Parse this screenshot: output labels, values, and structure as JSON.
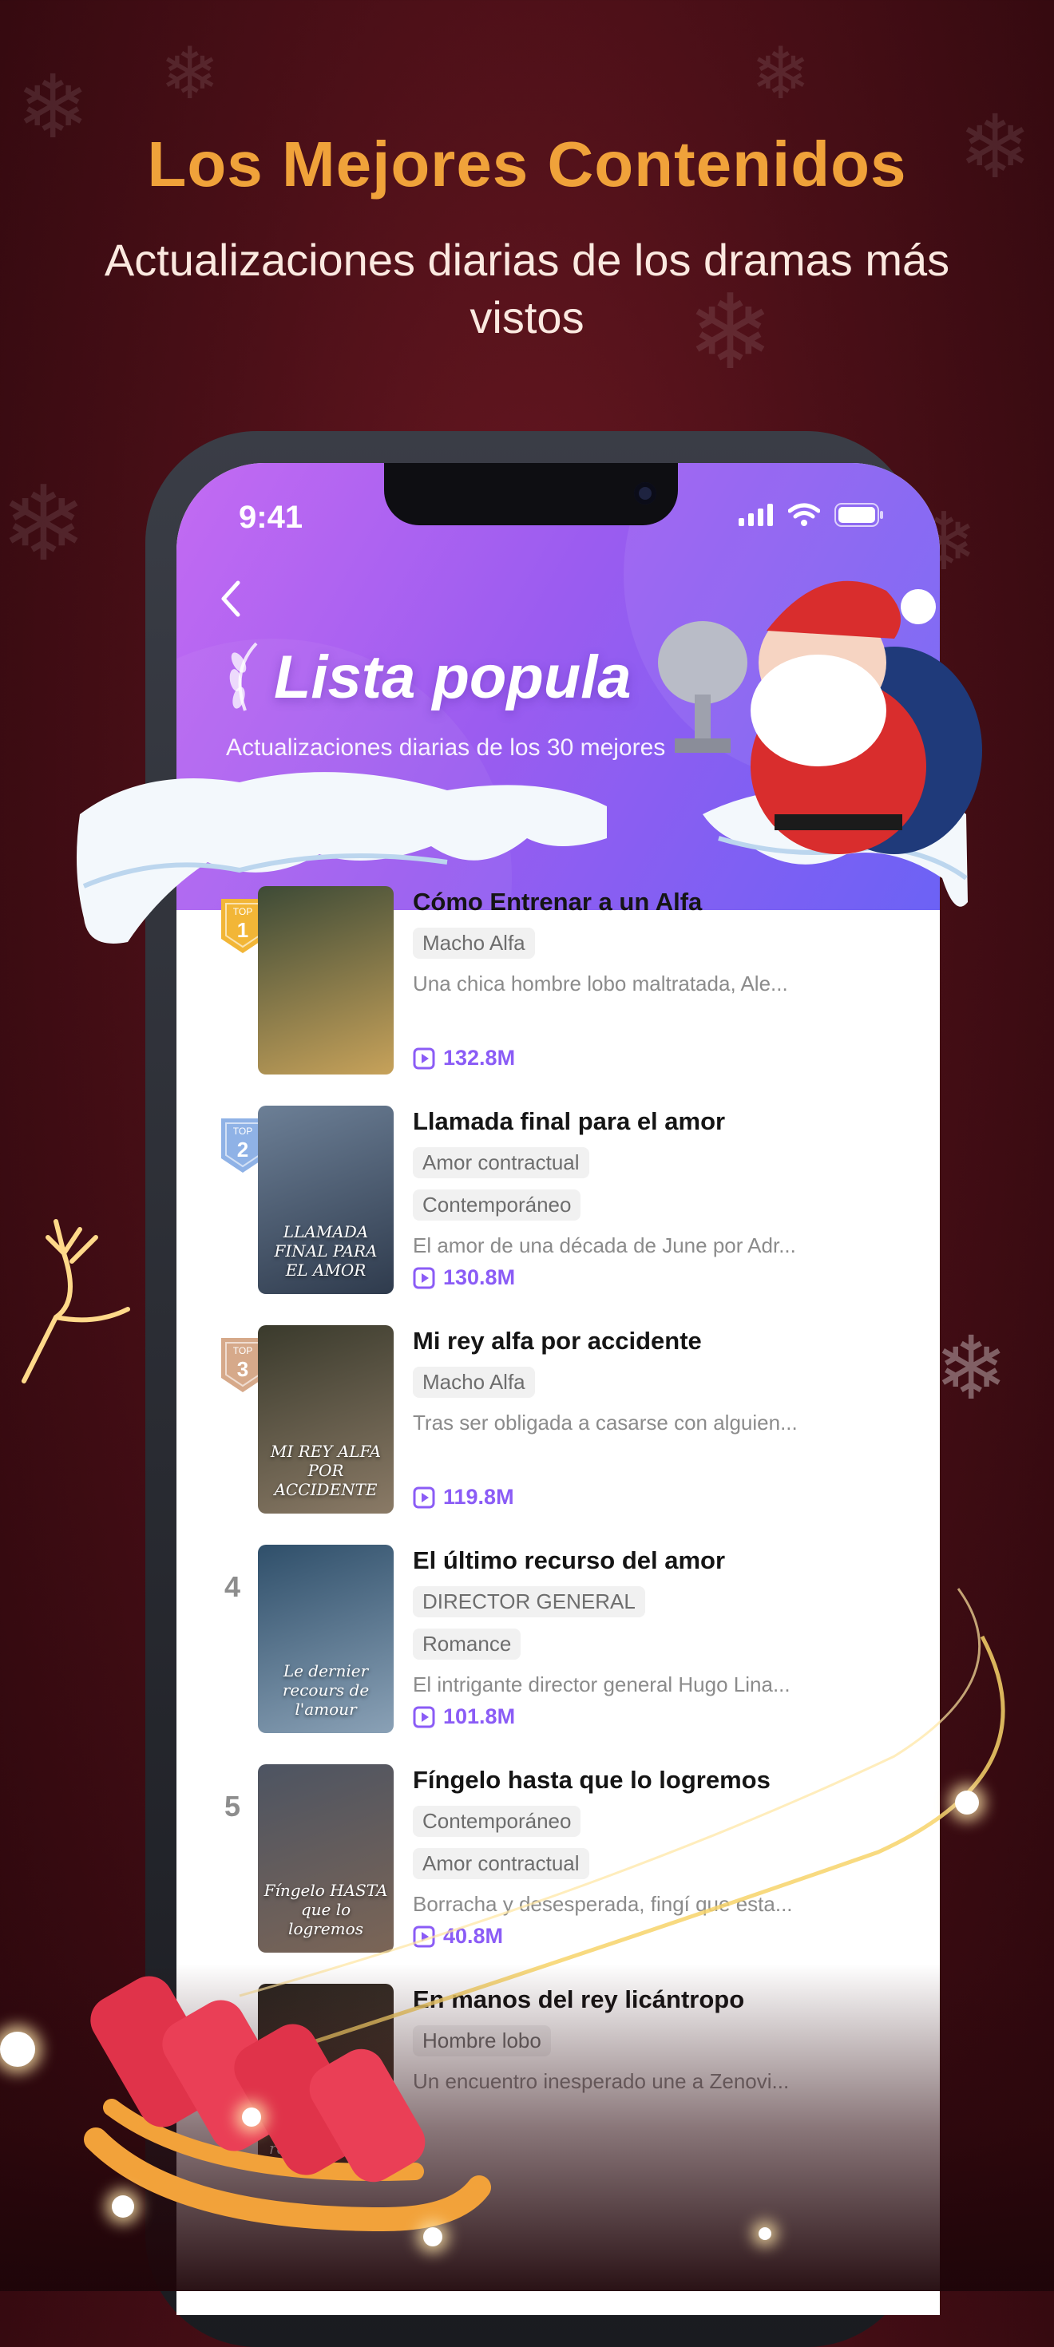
{
  "promo": {
    "headline": "Los Mejores Contenidos",
    "subheadline": "Actualizaciones diarias de los dramas más vistos"
  },
  "status_bar": {
    "time": "9:41",
    "icons": [
      "signal-icon",
      "wifi-icon",
      "battery-icon"
    ]
  },
  "header": {
    "back_icon": "chevron-left-icon",
    "title": "Lista popula",
    "tagline": "Actualizaciones diarias de los 30 mejores"
  },
  "badge_text": "TOP",
  "items": [
    {
      "rank": "1",
      "badge_color": "#f2b637",
      "title": "Cómo Entrenar a un Alfa",
      "tags": [
        "Macho Alfa"
      ],
      "description": "Una chica hombre lobo maltratada, Ale...",
      "views": "132.8M",
      "cover_text": "",
      "cover_colors": [
        "#3d4a36",
        "#c7a25a"
      ]
    },
    {
      "rank": "2",
      "badge_color": "#8fb2e6",
      "title": "Llamada final para el amor",
      "tags": [
        "Amor contractual",
        "Contemporáneo"
      ],
      "description": "El amor de una década de June por Adr...",
      "views": "130.8M",
      "cover_text": "LLAMADA FINAL PARA EL AMOR",
      "cover_colors": [
        "#6c7f96",
        "#2f3b4d"
      ]
    },
    {
      "rank": "3",
      "badge_color": "#d6a98a",
      "title": "Mi rey alfa por accidente",
      "tags": [
        "Macho Alfa"
      ],
      "description": "Tras ser obligada a casarse con alguien...",
      "views": "119.8M",
      "cover_text": "MI REY ALFA POR ACCIDENTE",
      "cover_colors": [
        "#3a3a2c",
        "#8a7a66"
      ]
    },
    {
      "rank": "4",
      "badge_color": "",
      "title": "El último recurso del amor",
      "tags": [
        "DIRECTOR GENERAL",
        "Romance"
      ],
      "description": "El intrigante director general Hugo Lina...",
      "views": "101.8M",
      "cover_text": "Le dernier recours de l'amour",
      "cover_colors": [
        "#2f4f6a",
        "#8aa1b6"
      ]
    },
    {
      "rank": "5",
      "badge_color": "",
      "title": "Fíngelo hasta que lo logremos",
      "tags": [
        "Contemporáneo",
        "Amor contractual"
      ],
      "description": "Borracha y desesperada, fingí que esta...",
      "views": "40.8M",
      "cover_text": "Fíngelo HASTA que lo logremos",
      "cover_colors": [
        "#4d5462",
        "#7b6556"
      ]
    },
    {
      "rank": "6",
      "badge_color": "",
      "title": "En manos del rey licántropo",
      "tags": [
        "Hombre lobo"
      ],
      "description": "Un encuentro inesperado une a Zenovi...",
      "views": "",
      "cover_text": "En manos del rey licántropo",
      "cover_colors": [
        "#2b2520",
        "#5c4a3a"
      ]
    }
  ]
}
